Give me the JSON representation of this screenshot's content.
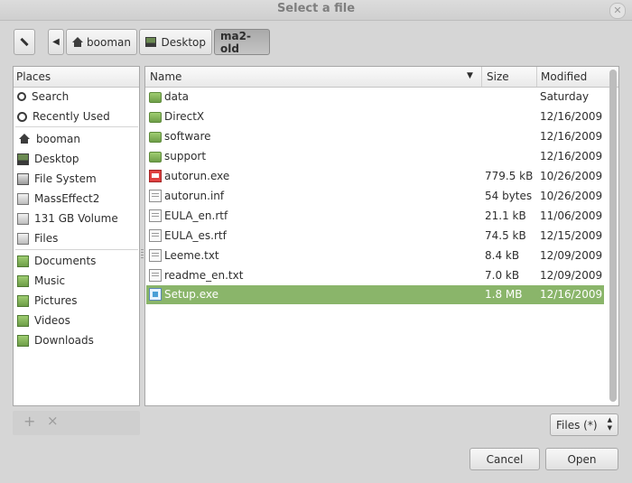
{
  "window": {
    "title": "Select a file",
    "close_glyph": "✕"
  },
  "pathbar": {
    "edit_icon": "pencil-icon",
    "back_glyph": "◀",
    "crumbs": [
      "booman",
      "Desktop",
      "ma2-old"
    ]
  },
  "places": {
    "header": "Places",
    "items": [
      "Search",
      "Recently Used",
      "booman",
      "Desktop",
      "File System",
      "MassEffect2",
      "131 GB Volume",
      "Files",
      "Documents",
      "Music",
      "Pictures",
      "Videos",
      "Downloads"
    ],
    "add_glyph": "+",
    "remove_glyph": "×"
  },
  "files": {
    "headers": {
      "name": "Name",
      "size": "Size",
      "modified": "Modified"
    },
    "sort_glyph": "▼",
    "rows": [
      {
        "name": "data",
        "size": "",
        "modified": "Saturday",
        "type": "folder"
      },
      {
        "name": "DirectX",
        "size": "",
        "modified": "12/16/2009",
        "type": "folder"
      },
      {
        "name": "software",
        "size": "",
        "modified": "12/16/2009",
        "type": "folder"
      },
      {
        "name": "support",
        "size": "",
        "modified": "12/16/2009",
        "type": "folder"
      },
      {
        "name": "autorun.exe",
        "size": "779.5 kB",
        "modified": "10/26/2009",
        "type": "exe"
      },
      {
        "name": "autorun.inf",
        "size": "54 bytes",
        "modified": "10/26/2009",
        "type": "doc"
      },
      {
        "name": "EULA_en.rtf",
        "size": "21.1 kB",
        "modified": "11/06/2009",
        "type": "doc"
      },
      {
        "name": "EULA_es.rtf",
        "size": "74.5 kB",
        "modified": "12/15/2009",
        "type": "doc"
      },
      {
        "name": "Leeme.txt",
        "size": "8.4 kB",
        "modified": "12/09/2009",
        "type": "doc"
      },
      {
        "name": "readme_en.txt",
        "size": "7.0 kB",
        "modified": "12/09/2009",
        "type": "doc"
      },
      {
        "name": "Setup.exe",
        "size": "1.8 MB",
        "modified": "12/16/2009",
        "type": "setup"
      }
    ],
    "selected_index": 10
  },
  "filter": {
    "label": "Files (*)",
    "up": "▲",
    "down": "▼"
  },
  "buttons": {
    "cancel": "Cancel",
    "open": "Open"
  },
  "colors": {
    "selection": "#8ab56a"
  }
}
